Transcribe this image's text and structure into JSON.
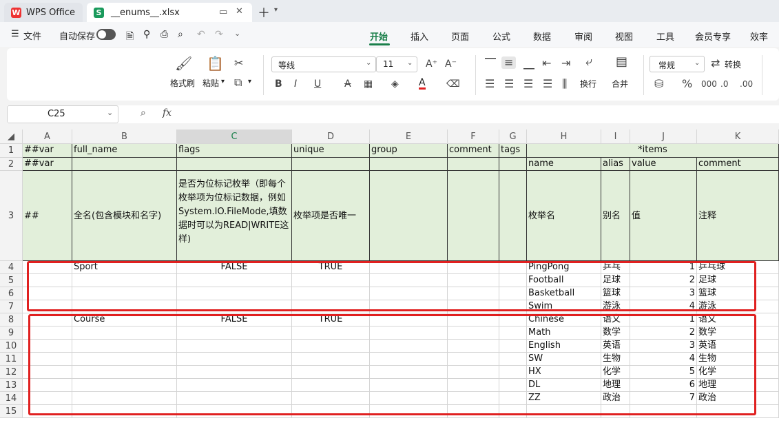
{
  "titlebar": {
    "app_tab": "WPS Office",
    "file_tab": "__enums__.xlsx",
    "new_tab_icon": "plus-icon"
  },
  "menubar": {
    "file_label": "文件",
    "autosave_label": "自动保存",
    "ribbon_tabs": [
      "开始",
      "插入",
      "页面",
      "公式",
      "数据",
      "审阅",
      "视图",
      "工具",
      "会员专享",
      "效率"
    ]
  },
  "ribbon": {
    "format_painter": "格式刷",
    "paste": "粘贴",
    "font_name": "等线",
    "font_size": "11",
    "wrap_text": "换行",
    "merge": "合并",
    "number_format": "常规",
    "convert": "转换"
  },
  "formula_bar": {
    "cell_ref": "C25",
    "fx_label": "fx",
    "formula": ""
  },
  "sheet": {
    "columns": [
      "A",
      "B",
      "C",
      "D",
      "E",
      "F",
      "G",
      "H",
      "I",
      "J",
      "K"
    ],
    "rows": [
      "1",
      "2",
      "3",
      "4",
      "5",
      "6",
      "7",
      "8",
      "9",
      "10",
      "11",
      "12",
      "13",
      "14",
      "15"
    ],
    "header_row1": {
      "a": "##var",
      "b": "full_name",
      "c": "flags",
      "d": "unique",
      "e": "group",
      "f": "comment",
      "g": "tags",
      "hk": "*items"
    },
    "header_row2": {
      "a": "##var",
      "h": "name",
      "i": "alias",
      "j": "value",
      "k": "comment"
    },
    "header_row3": {
      "a": "##",
      "b": "全名(包含模块和名字)",
      "c": "是否为位标记枚举（即每个枚举项为位标记数据，例如System.IO.FileMode,填数据时可以为READ|WRITE这样)",
      "d": "枚举项是否唯一",
      "h": "枚举名",
      "i": "别名",
      "j": "值",
      "k": "注释"
    },
    "enums": [
      {
        "full_name": "Sport",
        "flags": "FALSE",
        "unique": "TRUE",
        "items": [
          {
            "name": "PingPong",
            "alias": "乒乓",
            "value": "1",
            "comment": "乒乓球"
          },
          {
            "name": "Football",
            "alias": "足球",
            "value": "2",
            "comment": "足球"
          },
          {
            "name": "Basketball",
            "alias": "篮球",
            "value": "3",
            "comment": "篮球"
          },
          {
            "name": "Swim",
            "alias": "游泳",
            "value": "4",
            "comment": "游泳"
          }
        ]
      },
      {
        "full_name": "Course",
        "flags": "FALSE",
        "unique": "TRUE",
        "items": [
          {
            "name": "Chinese",
            "alias": "语文",
            "value": "1",
            "comment": "语文"
          },
          {
            "name": "Math",
            "alias": "数学",
            "value": "2",
            "comment": "数学"
          },
          {
            "name": "English",
            "alias": "英语",
            "value": "3",
            "comment": "英语"
          },
          {
            "name": "SW",
            "alias": "生物",
            "value": "4",
            "comment": "生物"
          },
          {
            "name": "HX",
            "alias": "化学",
            "value": "5",
            "comment": "化学"
          },
          {
            "name": "DL",
            "alias": "地理",
            "value": "6",
            "comment": "地理"
          },
          {
            "name": "ZZ",
            "alias": "政治",
            "value": "7",
            "comment": "政治"
          }
        ]
      }
    ]
  },
  "colors": {
    "header_fill": "#e2efda",
    "highlight_box": "#e02020",
    "accent": "#1a7f4a"
  }
}
